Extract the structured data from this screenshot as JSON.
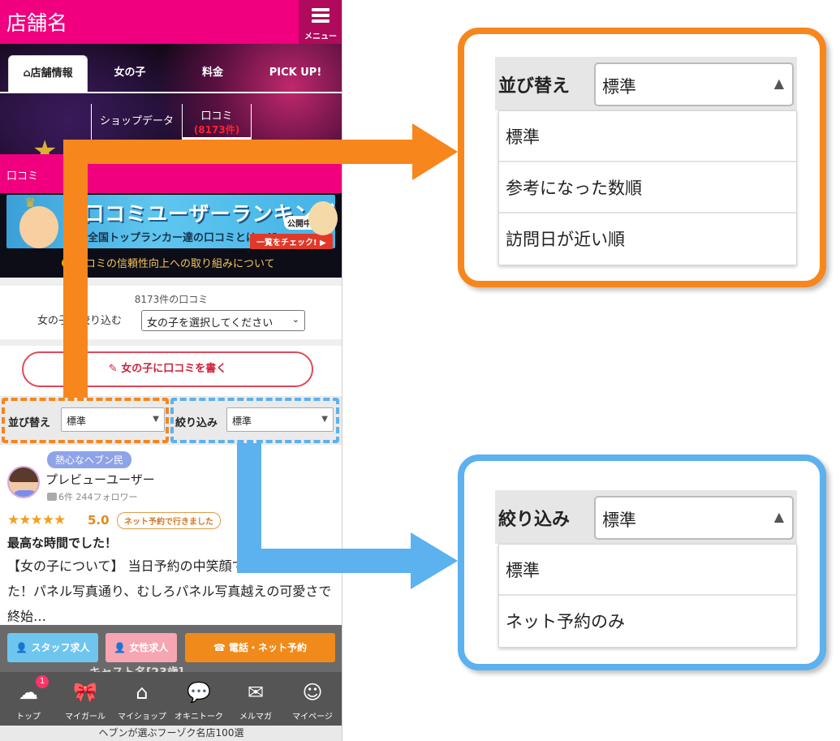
{
  "header": {
    "shop_name": "店舗名",
    "menu_label": "メニュー"
  },
  "tabs": [
    {
      "label": "店舗情報",
      "icon": "home-icon",
      "active": true
    },
    {
      "label": "女の子",
      "active": false
    },
    {
      "label": "料金",
      "active": false
    },
    {
      "label": "PICK UP!",
      "active": false
    }
  ],
  "subtabs": [
    {
      "label": "ショップデータ",
      "count": ""
    },
    {
      "label": "口コミ",
      "count": "(8173件)"
    }
  ],
  "section": {
    "title": "口コミ"
  },
  "banner": {
    "title": "口コミユーザーランキング",
    "subtitle": "全国トップランカー達の口コミとは…!?",
    "badge": "公開中!",
    "cta": "一覧をチェック! ▶",
    "trust_link": "口コミの信頼性向上への取り組みについて"
  },
  "review_count": "8173件の口コミ",
  "girl_filter": {
    "label": "女の子で絞り込む",
    "selected": "女の子を選択してください"
  },
  "write_button": "女の子に口コミを書く",
  "sort": {
    "label": "並び替え",
    "selected": "標準"
  },
  "narrow": {
    "label": "絞り込み",
    "selected": "標準"
  },
  "review": {
    "tag": "熱心なヘブン民",
    "user": "プレビューユーザー",
    "stats": "6件 244フォロワー",
    "stars": "★★★★★",
    "score": "5.0",
    "badge": "ネット予約で行きました",
    "title": "最高な時間でした！",
    "body": "【女の子について】 当日予約の中笑顔で出迎えてきました！パネル写真通り、むしろパネル写真越えの可愛さで終始…"
  },
  "float_buttons": {
    "staff": "スタッフ求人",
    "female": "女性求人",
    "call": "電話・ネット予約",
    "cast_peek": "キャスト名[23歳]"
  },
  "bottom_nav": [
    {
      "label": "トップ",
      "icon": "my-heaven-icon",
      "badge": "1"
    },
    {
      "label": "マイガール",
      "icon": "ribbon-icon"
    },
    {
      "label": "マイショップ",
      "icon": "shop-icon"
    },
    {
      "label": "オキニトーク",
      "icon": "chat-icon"
    },
    {
      "label": "メルマガ",
      "icon": "mail-icon"
    },
    {
      "label": "マイページ",
      "icon": "user-avatar-icon"
    }
  ],
  "footer_strip": "ヘブンが選ぶフーゾク名店100選",
  "callout_sort": {
    "label": "並び替え",
    "selected": "標準",
    "options": [
      "標準",
      "参考になった数順",
      "訪問日が近い順"
    ]
  },
  "callout_narrow": {
    "label": "絞り込み",
    "selected": "標準",
    "options": [
      "標準",
      "ネット予約のみ"
    ]
  },
  "colors": {
    "brand_pink": "#f0007f",
    "highlight_orange": "#f7861d",
    "highlight_blue": "#5cb1ef",
    "call_orange": "#f08a1a"
  }
}
